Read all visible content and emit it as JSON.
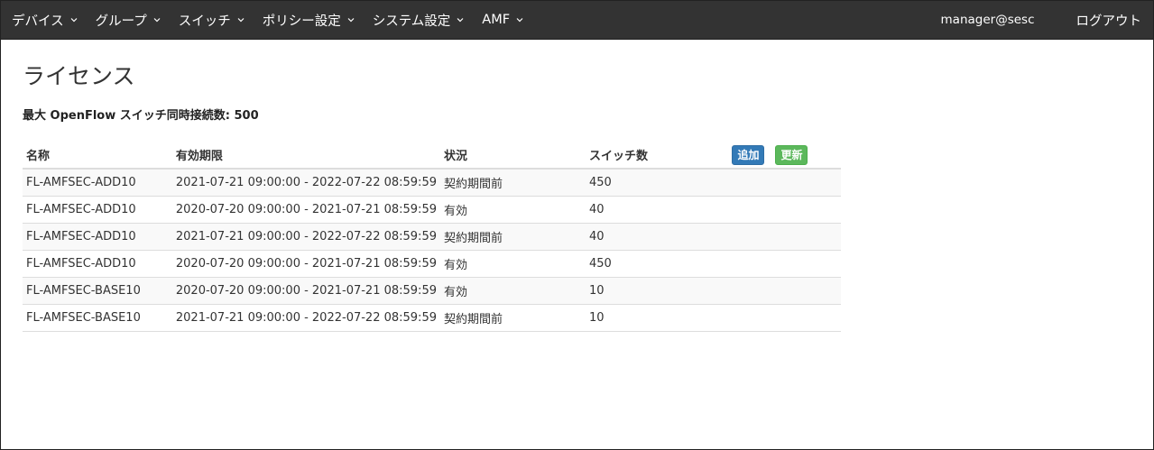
{
  "nav": {
    "items": [
      {
        "label": "デバイス"
      },
      {
        "label": "グループ"
      },
      {
        "label": "スイッチ"
      },
      {
        "label": "ポリシー設定"
      },
      {
        "label": "システム設定"
      },
      {
        "label": "AMF"
      }
    ],
    "user": "manager@sesc",
    "logout": "ログアウト"
  },
  "page": {
    "title": "ライセンス",
    "max_connections": "最大 OpenFlow スイッチ同時接続数: 500"
  },
  "table": {
    "headers": {
      "name": "名称",
      "period": "有効期限",
      "status": "状況",
      "switches": "スイッチ数"
    },
    "add_label": "追加",
    "update_label": "更新",
    "rows": [
      {
        "name": "FL-AMFSEC-ADD10",
        "period": "2021-07-21 09:00:00 - 2022-07-22 08:59:59",
        "status": "契約期間前",
        "switches": "450"
      },
      {
        "name": "FL-AMFSEC-ADD10",
        "period": "2020-07-20 09:00:00 - 2021-07-21 08:59:59",
        "status": "有効",
        "switches": "40"
      },
      {
        "name": "FL-AMFSEC-ADD10",
        "period": "2021-07-21 09:00:00 - 2022-07-22 08:59:59",
        "status": "契約期間前",
        "switches": "40"
      },
      {
        "name": "FL-AMFSEC-ADD10",
        "period": "2020-07-20 09:00:00 - 2021-07-21 08:59:59",
        "status": "有効",
        "switches": "450"
      },
      {
        "name": "FL-AMFSEC-BASE10",
        "period": "2020-07-20 09:00:00 - 2021-07-21 08:59:59",
        "status": "有効",
        "switches": "10"
      },
      {
        "name": "FL-AMFSEC-BASE10",
        "period": "2021-07-21 09:00:00 - 2022-07-22 08:59:59",
        "status": "契約期間前",
        "switches": "10"
      }
    ]
  },
  "colors": {
    "navbar": "#333333",
    "add_button": "#337ab7",
    "update_button": "#5cb85c"
  }
}
